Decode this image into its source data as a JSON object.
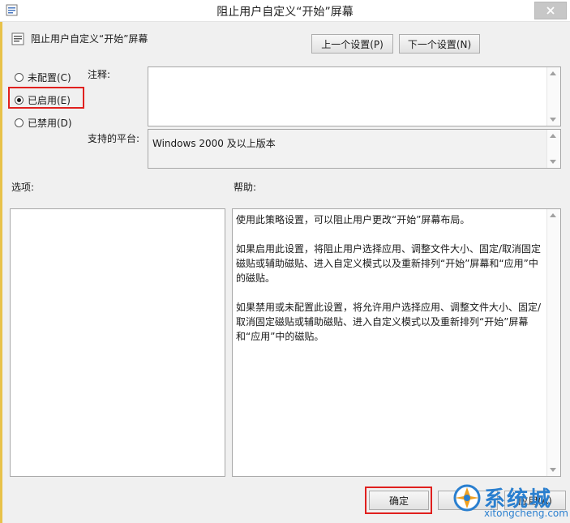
{
  "window": {
    "title": "阻止用户自定义“开始”屏幕"
  },
  "header": {
    "policy_name": "阻止用户自定义“开始”屏幕"
  },
  "nav": {
    "prev_label": "上一个设置(P)",
    "next_label": "下一个设置(N)"
  },
  "state": {
    "options": [
      {
        "label": "未配置(C)",
        "checked": false
      },
      {
        "label": "已启用(E)",
        "checked": true
      },
      {
        "label": "已禁用(D)",
        "checked": false
      }
    ]
  },
  "comment": {
    "label": "注释:",
    "value": ""
  },
  "platform": {
    "label": "支持的平台:",
    "value": "Windows 2000 及以上版本"
  },
  "options_section": {
    "label": "选项:"
  },
  "help_section": {
    "label": "帮助:",
    "paragraphs": [
      "使用此策略设置，可以阻止用户更改“开始”屏幕布局。",
      "如果启用此设置，将阻止用户选择应用、调整文件大小、固定/取消固定磁贴或辅助磁贴、进入自定义模式以及重新排列“开始”屏幕和“应用”中的磁贴。",
      "如果禁用或未配置此设置，将允许用户选择应用、调整文件大小、固定/取消固定磁贴或辅助磁贴、进入自定义模式以及重新排列“开始”屏幕和“应用”中的磁贴。"
    ]
  },
  "footer": {
    "ok_label": "确定",
    "cancel_label": "取消",
    "apply_label": "应用(A)"
  },
  "watermark": {
    "cn": "系统城",
    "en": "xitongcheng.com"
  },
  "colors": {
    "highlight_box": "#e0201e",
    "watermark": "#2a7fcf",
    "window_bg": "#f0f0f0"
  },
  "icons": {
    "app": "policy-app-icon",
    "header": "policy-setting-icon",
    "close": "close-icon"
  }
}
